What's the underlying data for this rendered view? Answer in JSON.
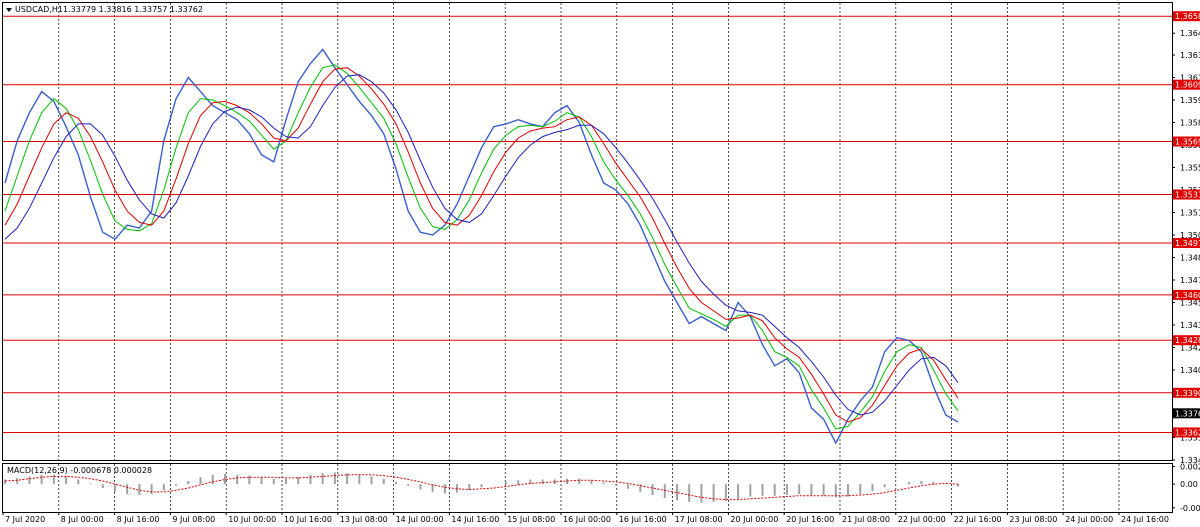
{
  "chart_header": {
    "symbol": "USDCAD,H1",
    "ohlc": "1.33779 1.33816 1.33757 1.33762"
  },
  "macd_header": {
    "label": "MACD(12,26,9) -0.000678 0.000028"
  },
  "colors": {
    "background": "#ffffff",
    "grid": "#000000",
    "price_line": "#3a5fcd",
    "ma_green": "#00c000",
    "ma_red": "#e00000",
    "ma_blue": "#2020c0",
    "level": "#e00000",
    "macd_hist": "#a0a0a0",
    "macd_signal": "#e00000",
    "current_tag": "#000000"
  },
  "chart_data": {
    "type": "line",
    "ylim": [
      1.3343,
      1.3668
    ],
    "y_ticks": [
      "1.36465",
      "1.36310",
      "1.36150",
      "1.35990",
      "1.35830",
      "1.35670",
      "1.35510",
      "1.35350",
      "1.35190",
      "1.35030",
      "1.34870",
      "1.34710",
      "1.34550",
      "1.34390",
      "1.34230",
      "1.34070",
      "1.33910",
      "1.33750",
      "1.33590",
      "1.33430"
    ],
    "x_labels": [
      "7 Jul 2020",
      "8 Jul 00:00",
      "8 Jul 16:00",
      "9 Jul 08:00",
      "10 Jul 00:00",
      "10 Jul 16:00",
      "13 Jul 08:00",
      "14 Jul 00:00",
      "14 Jul 16:00",
      "15 Jul 08:00",
      "16 Jul 00:00",
      "16 Jul 16:00",
      "17 Jul 08:00",
      "20 Jul 00:00",
      "20 Jul 16:00",
      "21 Jul 08:00",
      "22 Jul 00:00",
      "22 Jul 16:00",
      "23 Jul 08:00",
      "24 Jul 00:00",
      "24 Jul 16:00"
    ],
    "levels": [
      "1.36586",
      "1.36099",
      "1.35695",
      "1.35318",
      "1.34973",
      "1.34604",
      "1.34282",
      "1.33908",
      "1.33626"
    ],
    "current_price": "1.33762",
    "series": [
      {
        "values": [
          1.354,
          1.357,
          1.359,
          1.3605,
          1.3598,
          1.358,
          1.356,
          1.353,
          1.3505,
          1.35,
          1.351,
          1.3508,
          1.352,
          1.357,
          1.36,
          1.3615,
          1.3605,
          1.3595,
          1.359,
          1.3585,
          1.3575,
          1.356,
          1.3555,
          1.3585,
          1.3612,
          1.3625,
          1.3635,
          1.3622,
          1.361,
          1.3598,
          1.3588,
          1.3575,
          1.355,
          1.352,
          1.3505,
          1.3503,
          1.351,
          1.3525,
          1.3545,
          1.3565,
          1.358,
          1.3582,
          1.3585,
          1.3582,
          1.358,
          1.359,
          1.3595,
          1.3583,
          1.356,
          1.354,
          1.3535,
          1.3525,
          1.351,
          1.349,
          1.347,
          1.3455,
          1.344,
          1.3445,
          1.344,
          1.3435,
          1.3455,
          1.3445,
          1.3425,
          1.341,
          1.3415,
          1.3405,
          1.338,
          1.3372,
          1.3355,
          1.3372,
          1.3385,
          1.3395,
          1.342,
          1.343,
          1.3428,
          1.342,
          1.3395,
          1.3375,
          1.337
        ]
      },
      {
        "values": [
          1.352,
          1.3545,
          1.357,
          1.359,
          1.36,
          1.3593,
          1.3578,
          1.3556,
          1.3532,
          1.3513,
          1.3507,
          1.3506,
          1.3511,
          1.3535,
          1.3565,
          1.359,
          1.36,
          1.3599,
          1.3595,
          1.359,
          1.3584,
          1.3574,
          1.3564,
          1.357,
          1.359,
          1.3608,
          1.3622,
          1.3624,
          1.3618,
          1.3608,
          1.3597,
          1.3586,
          1.3568,
          1.3544,
          1.3522,
          1.3509,
          1.3507,
          1.3514,
          1.3528,
          1.3547,
          1.3564,
          1.3574,
          1.358,
          1.3581,
          1.358,
          1.3584,
          1.359,
          1.3587,
          1.3573,
          1.3555,
          1.3542,
          1.3531,
          1.3518,
          1.3501,
          1.3482,
          1.3466,
          1.3451,
          1.3447,
          1.3443,
          1.3438,
          1.3446,
          1.3446,
          1.3435,
          1.342,
          1.3416,
          1.341,
          1.3393,
          1.338,
          1.3365,
          1.3367,
          1.3377,
          1.3388,
          1.3406,
          1.342,
          1.3425,
          1.3423,
          1.3407,
          1.339,
          1.3378
        ]
      },
      {
        "values": [
          1.351,
          1.3525,
          1.3545,
          1.3565,
          1.3582,
          1.359,
          1.3586,
          1.3573,
          1.3555,
          1.3535,
          1.352,
          1.3512,
          1.351,
          1.352,
          1.3543,
          1.3568,
          1.3588,
          1.3597,
          1.3598,
          1.3595,
          1.359,
          1.3582,
          1.3572,
          1.357,
          1.3579,
          1.3596,
          1.3612,
          1.3621,
          1.3622,
          1.3616,
          1.3607,
          1.3596,
          1.3582,
          1.3562,
          1.354,
          1.3522,
          1.3512,
          1.351,
          1.3517,
          1.3531,
          1.3548,
          1.3562,
          1.3572,
          1.3577,
          1.3579,
          1.358,
          1.3585,
          1.3587,
          1.3581,
          1.3568,
          1.3554,
          1.3542,
          1.353,
          1.3515,
          1.3497,
          1.348,
          1.3465,
          1.3455,
          1.3449,
          1.3443,
          1.3444,
          1.3446,
          1.3442,
          1.343,
          1.3422,
          1.3416,
          1.3404,
          1.339,
          1.3375,
          1.337,
          1.3373,
          1.3382,
          1.3396,
          1.341,
          1.3419,
          1.3422,
          1.3414,
          1.34,
          1.3387
        ]
      },
      {
        "values": [
          1.35,
          1.3508,
          1.3522,
          1.354,
          1.3558,
          1.3573,
          1.3582,
          1.3582,
          1.3574,
          1.3559,
          1.3542,
          1.3528,
          1.3518,
          1.3515,
          1.3526,
          1.3545,
          1.3566,
          1.3582,
          1.3591,
          1.3594,
          1.3592,
          1.3587,
          1.3579,
          1.3573,
          1.3572,
          1.358,
          1.3595,
          1.3608,
          1.3616,
          1.3617,
          1.3612,
          1.3604,
          1.3592,
          1.3576,
          1.3556,
          1.3537,
          1.3522,
          1.3514,
          1.3512,
          1.3518,
          1.3531,
          1.3545,
          1.3558,
          1.3567,
          1.3573,
          1.3576,
          1.3578,
          1.3581,
          1.3581,
          1.3575,
          1.3565,
          1.3554,
          1.3542,
          1.3529,
          1.3514,
          1.3498,
          1.3483,
          1.347,
          1.3461,
          1.3453,
          1.3449,
          1.3448,
          1.3446,
          1.3438,
          1.343,
          1.3423,
          1.3413,
          1.3402,
          1.3389,
          1.3379,
          1.3375,
          1.3377,
          1.3385,
          1.3396,
          1.3407,
          1.3415,
          1.3416,
          1.341,
          1.3398
        ]
      }
    ],
    "macd": {
      "ylim": [
        -0.0036,
        0.0026
      ],
      "y_ticks": [
        "0.00226",
        "0.00",
        "-0.00306"
      ],
      "histogram": [
        0.0006,
        0.0008,
        0.001,
        0.0012,
        0.0012,
        0.001,
        0.0006,
        0.0001,
        -0.0005,
        -0.001,
        -0.0013,
        -0.0014,
        -0.0013,
        -0.0008,
        -0.0002,
        0.0004,
        0.0009,
        0.0012,
        0.0013,
        0.0012,
        0.0011,
        0.0009,
        0.0007,
        0.0007,
        0.0009,
        0.0012,
        0.0014,
        0.0015,
        0.0014,
        0.0012,
        0.001,
        0.0007,
        0.0003,
        -0.0002,
        -0.0007,
        -0.001,
        -0.0012,
        -0.0011,
        -0.0008,
        -0.0004,
        0.0,
        0.0003,
        0.0005,
        0.0006,
        0.0006,
        0.0006,
        0.0007,
        0.0007,
        0.0005,
        0.0002,
        -0.0002,
        -0.0006,
        -0.001,
        -0.0014,
        -0.0018,
        -0.0021,
        -0.0023,
        -0.0024,
        -0.0023,
        -0.0022,
        -0.0019,
        -0.0016,
        -0.0015,
        -0.0015,
        -0.0014,
        -0.0013,
        -0.0014,
        -0.0015,
        -0.0017,
        -0.0016,
        -0.0013,
        -0.0009,
        -0.0004,
        0.0,
        0.0003,
        0.0004,
        0.0003,
        0.0001,
        -0.0003
      ],
      "signal": [
        0.0004,
        0.0005,
        0.0007,
        0.0009,
        0.001,
        0.001,
        0.0009,
        0.0007,
        0.0004,
        0.0,
        -0.0004,
        -0.0008,
        -0.001,
        -0.001,
        -0.0008,
        -0.0005,
        -0.0001,
        0.0003,
        0.0006,
        0.0008,
        0.0009,
        0.0009,
        0.0009,
        0.0008,
        0.0008,
        0.0009,
        0.001,
        0.0011,
        0.0012,
        0.0012,
        0.0012,
        0.0011,
        0.0009,
        0.0006,
        0.0003,
        -0.0001,
        -0.0004,
        -0.0006,
        -0.0007,
        -0.0006,
        -0.0005,
        -0.0003,
        -0.0001,
        0.0001,
        0.0002,
        0.0003,
        0.0004,
        0.0005,
        0.0005,
        0.0004,
        0.0003,
        0.0001,
        -0.0002,
        -0.0005,
        -0.0008,
        -0.0011,
        -0.0014,
        -0.0017,
        -0.0019,
        -0.002,
        -0.002,
        -0.0019,
        -0.0018,
        -0.0017,
        -0.0016,
        -0.0015,
        -0.0015,
        -0.0015,
        -0.0015,
        -0.0015,
        -0.0014,
        -0.0013,
        -0.0011,
        -0.0008,
        -0.0005,
        -0.0002,
        0.0,
        0.0001,
        0.0
      ]
    }
  }
}
